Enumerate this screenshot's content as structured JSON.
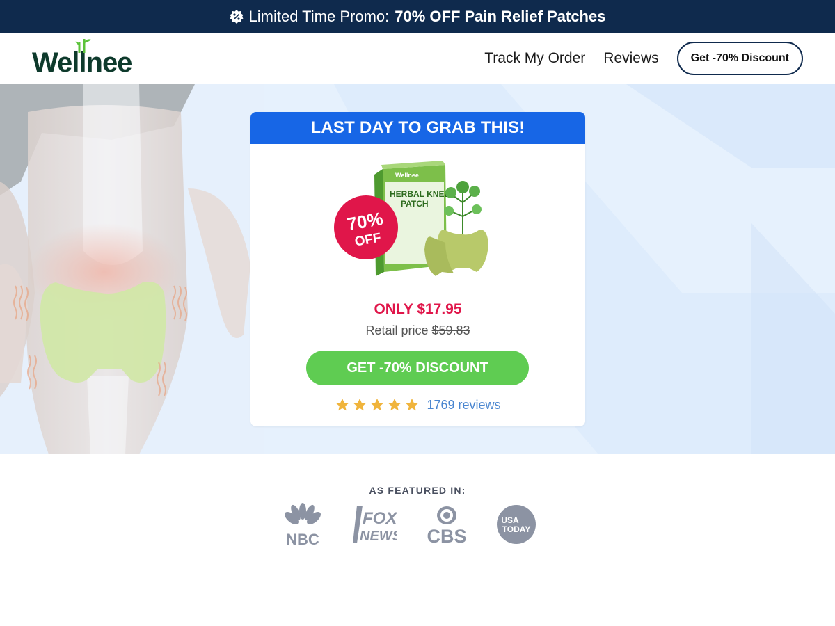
{
  "promo": {
    "prefix": "Limited Time Promo:",
    "highlight": "70% OFF Pain Relief Patches"
  },
  "header": {
    "logo_text": "Wellnee",
    "nav": {
      "track_order": "Track My Order",
      "reviews": "Reviews",
      "cta": "Get -70% Discount"
    }
  },
  "offer": {
    "banner": "LAST DAY TO GRAB THIS!",
    "product_box_brand": "Wellnee",
    "product_box_title_line1": "HERBAL KNEE",
    "product_box_title_line2": "PATCH",
    "badge_percent": "70%",
    "badge_off": "OFF",
    "price_now": "ONLY $17.95",
    "retail_label": "Retail price",
    "retail_price": "$59.83",
    "cta": "GET -70% DISCOUNT",
    "rating_stars": 5,
    "reviews": "1769 reviews"
  },
  "featured": {
    "label": "AS FEATURED IN:",
    "logos": {
      "nbc": "NBC",
      "fox_line1": "FOX",
      "fox_line2": "NEWS",
      "cbs": "CBS",
      "usa_line1": "USA",
      "usa_line2": "TODAY"
    }
  },
  "colors": {
    "promo_bg": "#0f2a4d",
    "banner_blue": "#1766e6",
    "price_red": "#e0164a",
    "cta_green": "#5fcc52",
    "star_gold": "#f0b43c",
    "hero_bg": "#e6f1fd"
  }
}
